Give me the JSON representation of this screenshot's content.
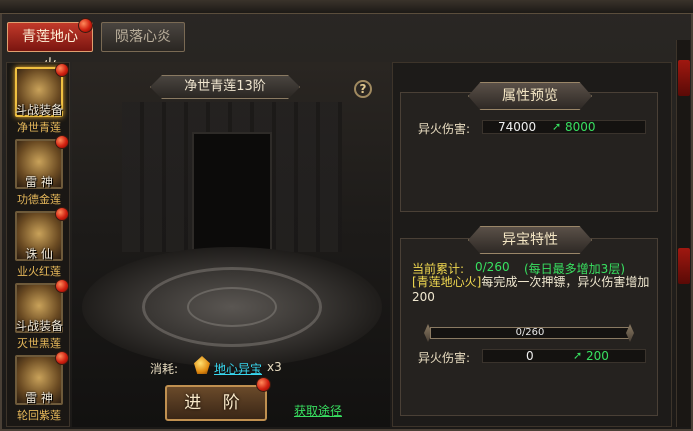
{
  "tabs": [
    {
      "label": "青莲地心火",
      "active": true
    },
    {
      "label": "陨落心炎",
      "active": false
    }
  ],
  "heroes": [
    {
      "name": "斗战装备",
      "sub": "净世青莲",
      "active": true
    },
    {
      "name": "雷 神",
      "sub": "功德金莲",
      "active": false
    },
    {
      "name": "诛 仙",
      "sub": "业火红莲",
      "active": false
    },
    {
      "name": "斗战装备",
      "sub": "灭世黑莲",
      "active": false
    },
    {
      "name": "雷 神",
      "sub": "轮回紫莲",
      "active": false
    }
  ],
  "stage": {
    "title": "净世青莲13阶",
    "help_icon": "question-icon",
    "help_label": "?"
  },
  "cost": {
    "label": "消耗:",
    "item": "地心异宝",
    "count": "x3",
    "icon": "gem-icon"
  },
  "advance_label": "进 阶",
  "obtain_label": "获取途径",
  "attr_preview": {
    "title": "属性预览",
    "stat_label": "异火伤害:",
    "value": "74000",
    "add": "8000"
  },
  "special": {
    "title": "异宝特性",
    "current_label": "当前累计:",
    "current_value": "0/260",
    "current_note": "(每日最多增加3层)",
    "desc_highlight": "[青莲地心火]",
    "desc_rest": "每完成一次押镖，异火伤害增加200",
    "progress_text": "0/260",
    "progress_value": 0,
    "stat_label": "异火伤害:",
    "value": "0",
    "add": "200"
  },
  "colors": {
    "accent_red": "#c23a2a",
    "green": "#38e060",
    "gold": "#f0d850",
    "cyan": "#38d8f0"
  }
}
